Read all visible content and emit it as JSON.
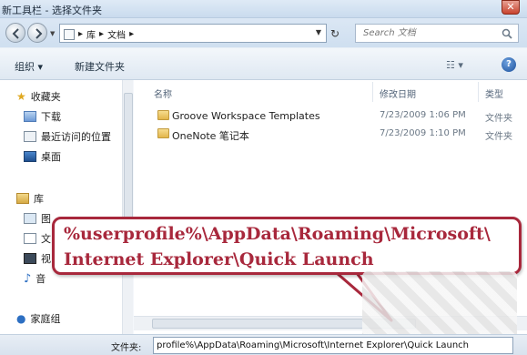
{
  "window": {
    "title": "新工具栏 - 选择文件夹"
  },
  "address": {
    "crumbs": [
      "库",
      "文档"
    ],
    "search_placeholder": "Search 文档"
  },
  "toolbar": {
    "organize": "组织 ▾",
    "new_folder": "新建文件夹"
  },
  "nav": {
    "favorites": "收藏夹",
    "downloads": "下载",
    "recent": "最近访问的位置",
    "desktop": "桌面",
    "libraries": "库",
    "lib_pictures": "图",
    "lib_docs": "文",
    "lib_video": "视",
    "lib_music": "音",
    "homegroup": "家庭组"
  },
  "columns": {
    "name": "名称",
    "date": "修改日期",
    "type": "类型"
  },
  "files": [
    {
      "name": "Groove Workspace Templates",
      "date": "7/23/2009 1:06 PM",
      "type": "文件夹"
    },
    {
      "name": "OneNote 笔记本",
      "date": "7/23/2009 1:10 PM",
      "type": "文件夹"
    }
  ],
  "callout": {
    "line1": "%userprofile%\\AppData\\Roaming\\Microsoft\\",
    "line2": "Internet Explorer\\Quick Launch"
  },
  "footer": {
    "folder_label": "文件夹:",
    "folder_value": "profile%\\AppData\\Roaming\\Microsoft\\Internet Explorer\\Quick Launch"
  },
  "colors": {
    "callout_border": "#a8283c",
    "callout_text": "#a8283c"
  },
  "icons": [
    "back-icon",
    "forward-icon",
    "refresh-icon",
    "search-icon",
    "help-icon",
    "star-icon",
    "folder-icon"
  ]
}
